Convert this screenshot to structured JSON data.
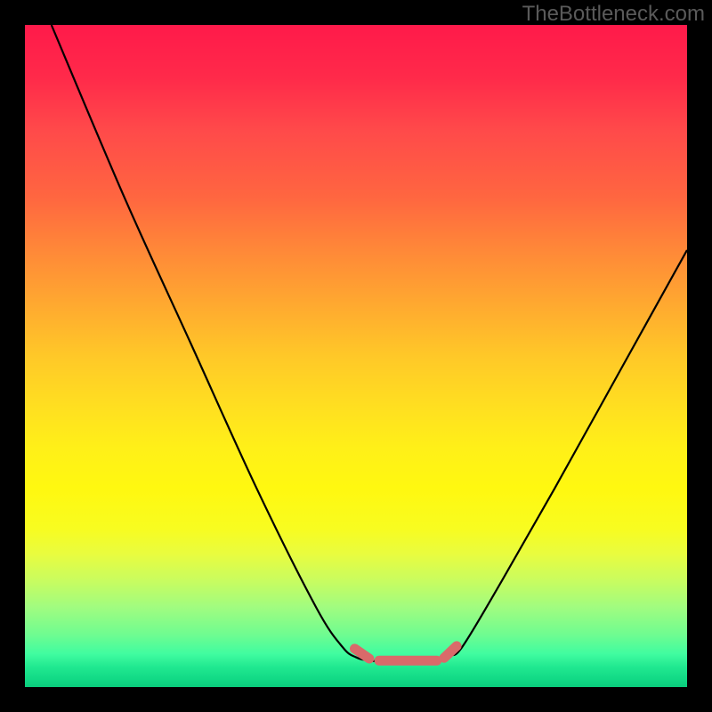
{
  "watermark": "TheBottleneck.com",
  "chart_data": {
    "type": "line",
    "title": "",
    "xlabel": "",
    "ylabel": "",
    "xlim": [
      0,
      100
    ],
    "ylim": [
      0,
      100
    ],
    "series": [
      {
        "name": "curve",
        "points": [
          [
            4,
            100
          ],
          [
            15,
            74
          ],
          [
            25,
            52
          ],
          [
            35,
            30
          ],
          [
            44,
            12
          ],
          [
            48,
            6
          ],
          [
            50,
            4.5
          ],
          [
            52,
            4
          ],
          [
            56,
            3.8
          ],
          [
            60,
            3.8
          ],
          [
            62,
            4
          ],
          [
            64,
            4.8
          ],
          [
            66,
            6
          ],
          [
            72,
            16
          ],
          [
            80,
            30
          ],
          [
            90,
            48
          ],
          [
            100,
            66
          ]
        ]
      }
    ],
    "marker_segments": [
      {
        "points": [
          [
            49.8,
            5.8
          ],
          [
            52,
            4.3
          ]
        ]
      },
      {
        "points": [
          [
            53.5,
            4.0
          ],
          [
            62.2,
            4.0
          ]
        ]
      },
      {
        "points": [
          [
            63.3,
            4.4
          ],
          [
            65.2,
            6.2
          ]
        ]
      }
    ],
    "gradient_stops": [
      {
        "pos": 0,
        "color": "#ff1a4a"
      },
      {
        "pos": 100,
        "color": "#0acc7c"
      }
    ]
  }
}
